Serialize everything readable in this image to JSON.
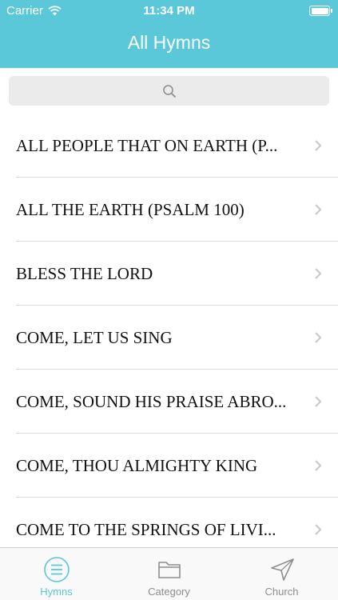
{
  "status_bar": {
    "carrier": "Carrier",
    "time": "11:34 PM",
    "wifi_icon": "wifi-icon",
    "battery_icon": "battery-icon"
  },
  "nav": {
    "title": "All Hymns"
  },
  "search": {
    "icon": "search-icon",
    "placeholder": ""
  },
  "hymns": [
    {
      "title": "ALL PEOPLE THAT ON EARTH (P..."
    },
    {
      "title": "ALL THE EARTH (PSALM 100)"
    },
    {
      "title": "BLESS THE LORD"
    },
    {
      "title": "COME, LET US SING"
    },
    {
      "title": "COME, SOUND HIS PRAISE ABRO..."
    },
    {
      "title": "COME, THOU ALMIGHTY KING"
    },
    {
      "title": "COME TO THE SPRINGS OF LIVI..."
    }
  ],
  "tabs": [
    {
      "label": "Hymns",
      "icon": "list-icon",
      "active": true
    },
    {
      "label": "Category",
      "icon": "folder-icon",
      "active": false
    },
    {
      "label": "Church",
      "icon": "location-arrow-icon",
      "active": false
    }
  ],
  "colors": {
    "accent": "#5ac8d8",
    "tab_inactive": "#8e8e8e",
    "separator": "#dcdcdc"
  }
}
